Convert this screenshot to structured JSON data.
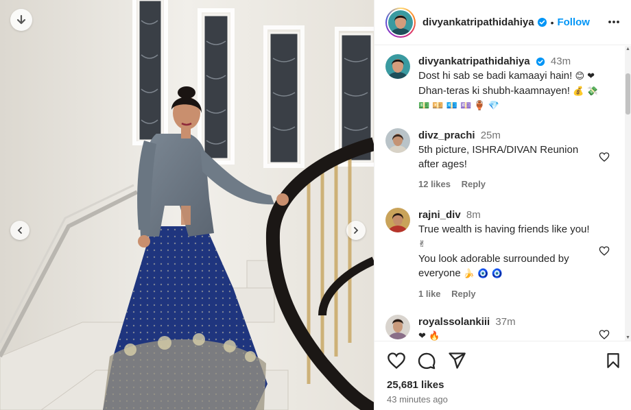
{
  "post": {
    "username": "divyankatripathidahiya",
    "follow_label": "Follow",
    "separator": "•",
    "likes": "25,681 likes",
    "time_ago": "43 minutes ago"
  },
  "caption": {
    "username": "divyankatripathidahiya",
    "time": "43m",
    "line1": "Dost hi sab se badi kamaayi hain!",
    "line1_emoji": "😊 ❤",
    "line2": "Dhan-teras ki shubh-kaamnayen!",
    "line2_emoji": "💰 💸",
    "line3_emoji": "💵 💴 💶 💷 🏺 💎"
  },
  "comments": [
    {
      "username": "divz_prachi",
      "time": "25m",
      "text": "5th picture, ISHRA/DIVAN Reunion after ages!",
      "likes": "12 likes",
      "reply": "Reply"
    },
    {
      "username": "rajni_div",
      "time": "8m",
      "text1": "True wealth is having friends like you!",
      "text1_emoji": "✌",
      "text2": "You look adorable surrounded by everyone",
      "text2_emoji": "🍌 🧿 🧿",
      "likes": "1 like",
      "reply": "Reply"
    },
    {
      "username": "royalssolankiii",
      "time": "37m",
      "text_emoji": "❤ 🔥"
    }
  ],
  "colors": {
    "accent": "#0095f6",
    "text": "#262626",
    "muted": "#737373",
    "border": "#efefef"
  },
  "icons": {
    "download": "arrow-down-icon",
    "prev": "chevron-left-icon",
    "next": "chevron-right-icon",
    "verified": "verified-badge-icon",
    "more": "more-options-icon",
    "like": "heart-icon",
    "comment": "comment-bubble-icon",
    "share": "paper-plane-icon",
    "save": "bookmark-icon"
  }
}
